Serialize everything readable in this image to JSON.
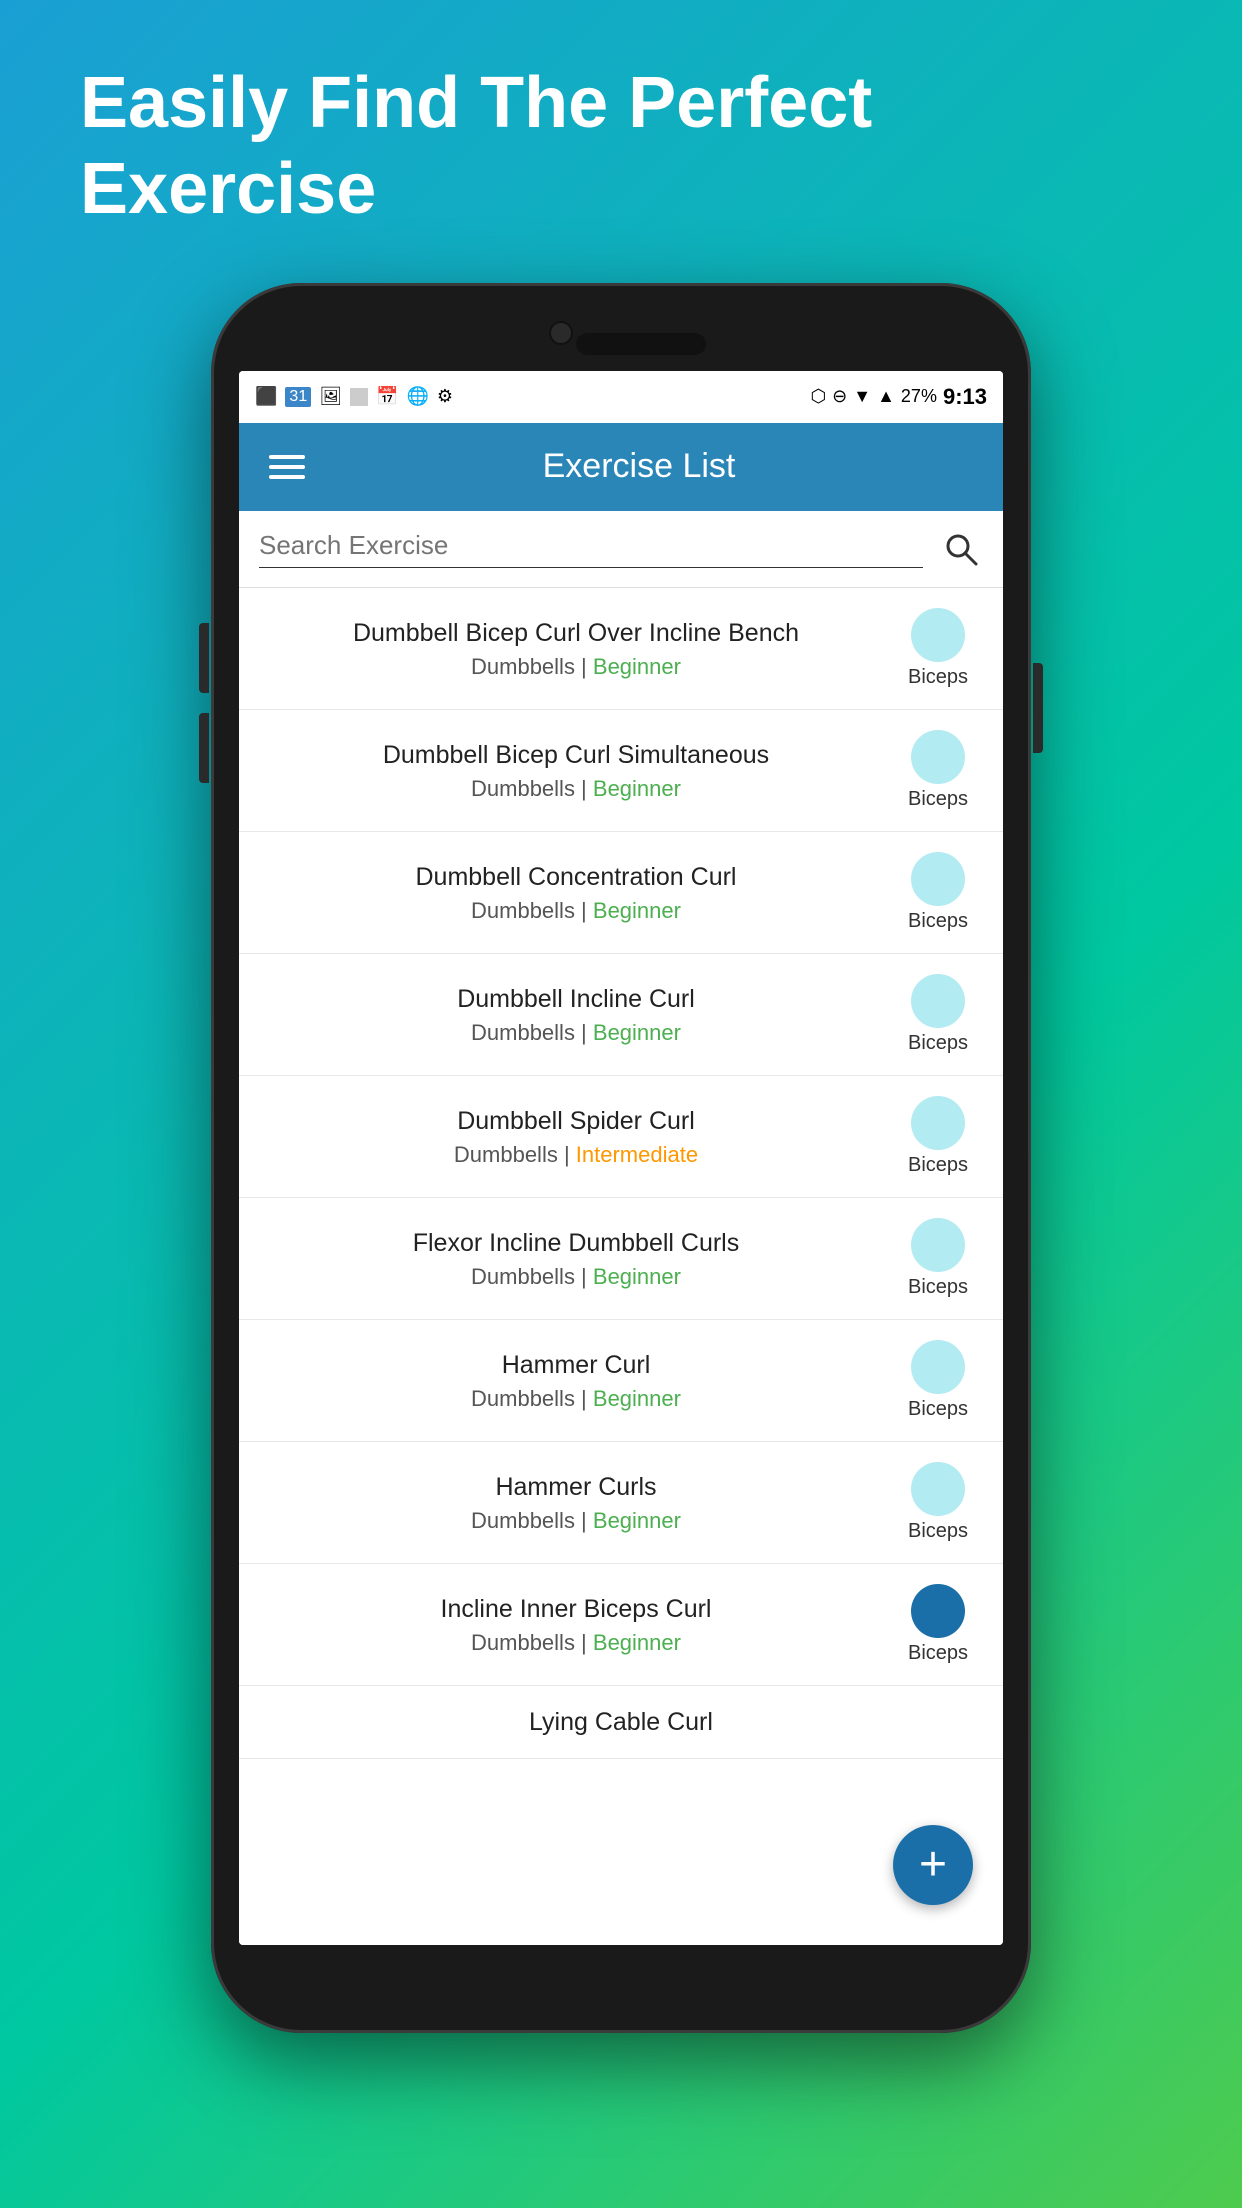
{
  "hero": {
    "title": "Easily Find The Perfect Exercise"
  },
  "status_bar": {
    "left_icons": [
      "⬛",
      "31",
      "🖼",
      "◻",
      "📅",
      "🌐",
      "⚙"
    ],
    "battery": "27%",
    "time": "9:13"
  },
  "app_bar": {
    "title": "Exercise List"
  },
  "search": {
    "placeholder": "Search Exercise"
  },
  "exercises": [
    {
      "name": "Dumbbell Bicep Curl Over Incline Bench",
      "equipment": "Dumbbells",
      "level": "Beginner",
      "level_class": "beginner",
      "muscle": "Biceps"
    },
    {
      "name": "Dumbbell Bicep Curl Simultaneous",
      "equipment": "Dumbbells",
      "level": "Beginner",
      "level_class": "beginner",
      "muscle": "Biceps"
    },
    {
      "name": "Dumbbell Concentration Curl",
      "equipment": "Dumbbells",
      "level": "Beginner",
      "level_class": "beginner",
      "muscle": "Biceps"
    },
    {
      "name": "Dumbbell Incline Curl",
      "equipment": "Dumbbells",
      "level": "Beginner",
      "level_class": "beginner",
      "muscle": "Biceps"
    },
    {
      "name": "Dumbbell Spider Curl",
      "equipment": "Dumbbells",
      "level": "Intermediate",
      "level_class": "intermediate",
      "muscle": "Biceps"
    },
    {
      "name": "Flexor Incline Dumbbell Curls",
      "equipment": "Dumbbells",
      "level": "Beginner",
      "level_class": "beginner",
      "muscle": "Biceps"
    },
    {
      "name": "Hammer Curl",
      "equipment": "Dumbbells",
      "level": "Beginner",
      "level_class": "beginner",
      "muscle": "Biceps"
    },
    {
      "name": "Hammer Curls",
      "equipment": "Dumbbells",
      "level": "Beginner",
      "level_class": "beginner",
      "muscle": "Biceps"
    },
    {
      "name": "Incline Inner Biceps Curl",
      "equipment": "Dumbbells",
      "level": "Beginner",
      "level_class": "beginner",
      "muscle": "Biceps",
      "fab_overlap": true
    },
    {
      "name": "Lying Cable Curl",
      "equipment": "",
      "level": "",
      "level_class": "",
      "muscle": ""
    }
  ],
  "fab": {
    "label": "+"
  },
  "colors": {
    "beginner": "#4caf50",
    "intermediate": "#ff9800",
    "app_bar": "#2b86b8",
    "fab": "#1a6fa8",
    "muscle_circle_light": "#b2ebf2",
    "muscle_circle_dark": "#1a6fa8"
  }
}
